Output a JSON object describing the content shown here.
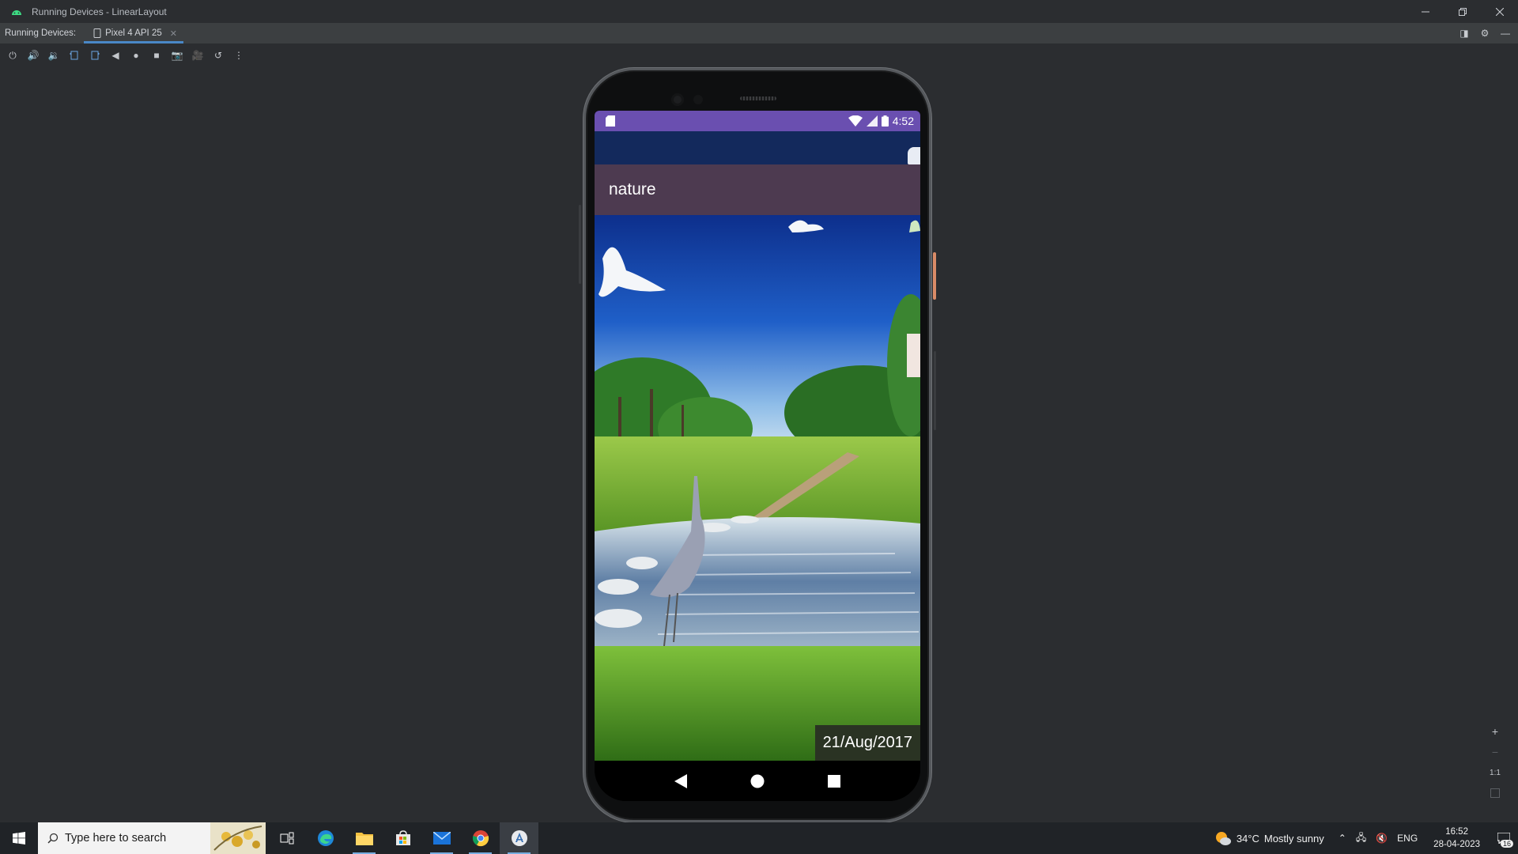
{
  "window": {
    "title": "Running Devices - LinearLayout",
    "controls": [
      "minimize",
      "restore",
      "close"
    ]
  },
  "tabbar": {
    "label": "Running Devices:",
    "device_tab": "Pixel 4 API 25"
  },
  "toolbar": {
    "icons": [
      "power-icon",
      "volume-up-icon",
      "volume-down-icon",
      "rotate-left-icon",
      "rotate-right-icon",
      "back-icon",
      "home-icon",
      "overview-icon",
      "screenshot-icon",
      "screen-record-icon",
      "reset-icon",
      "more-icon"
    ]
  },
  "phone": {
    "status_time": "4:52",
    "app_title": "nature",
    "date_label": "21/Aug/2017",
    "status_bar_color": "#6a4fb0",
    "app_bar_color": "#4d3a50"
  },
  "zoom": {
    "zoom_in": "+",
    "zoom_out": "−",
    "actual_size": "1:1"
  },
  "taskbar": {
    "search_placeholder": "Type here to search",
    "weather_temp": "34°C",
    "weather_desc": "Mostly sunny",
    "language": "ENG",
    "time": "16:52",
    "date": "28-04-2023",
    "notification_count": "16"
  }
}
